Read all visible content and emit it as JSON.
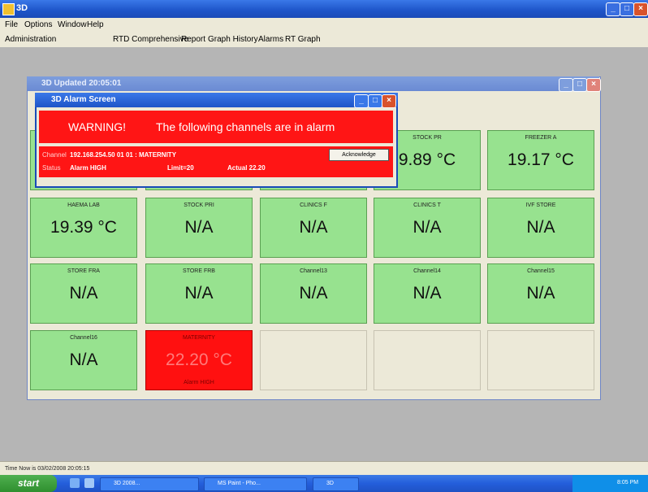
{
  "app": {
    "title": "3D"
  },
  "menu": [
    "File",
    "Options",
    "Window",
    "Help"
  ],
  "toolbar": [
    "Administration",
    "RTD Comprehensive",
    "Report",
    "Graph History",
    "Alarms",
    "RT Graph"
  ],
  "inner_window": {
    "title": "3D Updated 20:05:01"
  },
  "alarm_dialog": {
    "title": "3D   Alarm Screen",
    "warning": "WARNING!",
    "message": "The following channels are in alarm",
    "channel_label": "Channel",
    "channel_value": "192.168.254.50 01 01 : MATERNITY",
    "status_label": "Status",
    "status_value": "Alarm HIGH",
    "limit": "Limit=20",
    "actual": "Actual 22.20",
    "ack_label": "Acknowledge"
  },
  "channels": [
    {
      "label": "STOCK PR",
      "value": "9.89 °C",
      "state": "ok"
    },
    {
      "label": "FREEZER A",
      "value": "19.17 °C",
      "state": "ok"
    },
    {
      "label": "HAEMA LAB",
      "value": "19.39 °C",
      "state": "ok"
    },
    {
      "label": "STOCK PRI",
      "value": "N/A",
      "state": "ok"
    },
    {
      "label": "CLINICS F",
      "value": "N/A",
      "state": "ok"
    },
    {
      "label": "CLINICS T",
      "value": "N/A",
      "state": "ok"
    },
    {
      "label": "IVF STORE",
      "value": "N/A",
      "state": "ok"
    },
    {
      "label": "STORE FRA",
      "value": "N/A",
      "state": "ok"
    },
    {
      "label": "STORE FRB",
      "value": "N/A",
      "state": "ok"
    },
    {
      "label": "Channel13",
      "value": "N/A",
      "state": "ok"
    },
    {
      "label": "Channel14",
      "value": "N/A",
      "state": "ok"
    },
    {
      "label": "Channel15",
      "value": "N/A",
      "state": "ok"
    },
    {
      "label": "Channel16",
      "value": "N/A",
      "state": "ok"
    },
    {
      "label": "MATERNITY",
      "value": "22.20 °C",
      "state": "alarm",
      "sub": "Alarm HIGH"
    }
  ],
  "status_bar": "Time Now is 03/02/2008 20:05:15",
  "taskbar": {
    "start": "start",
    "items": [
      "3D   2008...",
      "3D   2008...",
      "MS Paint - Pho...",
      "3D"
    ],
    "clock": "8:05 PM"
  }
}
